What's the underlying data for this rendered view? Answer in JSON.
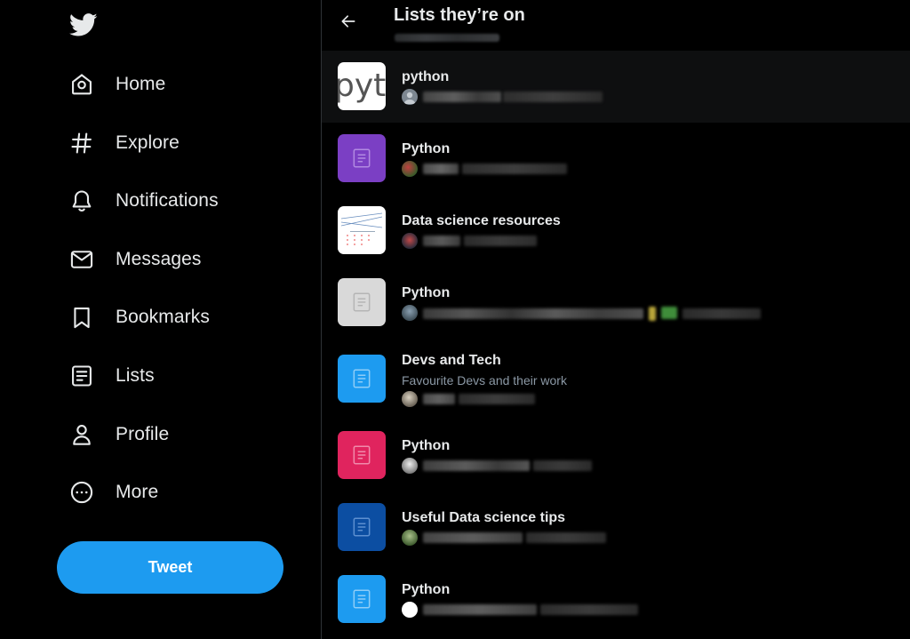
{
  "sidebar": {
    "nav": [
      {
        "label": "Home",
        "icon": "home-icon"
      },
      {
        "label": "Explore",
        "icon": "hashtag-icon"
      },
      {
        "label": "Notifications",
        "icon": "bell-icon"
      },
      {
        "label": "Messages",
        "icon": "envelope-icon"
      },
      {
        "label": "Bookmarks",
        "icon": "bookmark-icon"
      },
      {
        "label": "Lists",
        "icon": "list-icon"
      },
      {
        "label": "Profile",
        "icon": "person-icon"
      },
      {
        "label": "More",
        "icon": "more-circle-icon"
      }
    ],
    "tweet_label": "Tweet"
  },
  "header": {
    "title": "Lists they’re on"
  },
  "lists": [
    {
      "name": "python",
      "desc": "",
      "thumb": "pyt-logo"
    },
    {
      "name": "Python",
      "desc": "",
      "thumb": "#7b3fc4"
    },
    {
      "name": "Data science resources",
      "desc": "",
      "thumb": "chart-image"
    },
    {
      "name": "Python",
      "desc": "",
      "thumb": "#d9d9d9"
    },
    {
      "name": "Devs and Tech",
      "desc": "Favourite Devs and their work",
      "thumb": "#1d9bf0"
    },
    {
      "name": "Python",
      "desc": "",
      "thumb": "#e0245e"
    },
    {
      "name": "Useful Data science tips",
      "desc": "",
      "thumb": "#0c4ea2"
    },
    {
      "name": "Python",
      "desc": "",
      "thumb": "#1d9bf0"
    }
  ],
  "colors": {
    "accent": "#1d9bf0",
    "background": "#000000",
    "text": "#e7e9ea",
    "secondary_text": "#8b98a5"
  }
}
